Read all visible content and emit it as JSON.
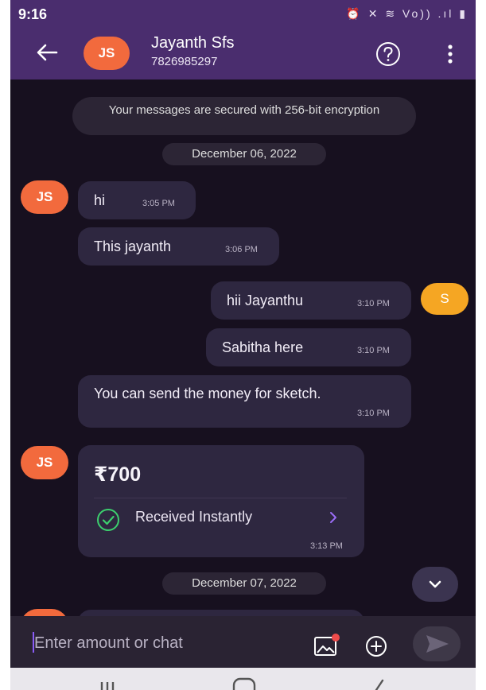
{
  "status_bar": {
    "time": "9:16",
    "icons": [
      "alarm-icon",
      "mute-icon",
      "wifi-icon",
      "volte-icon",
      "signal-icon",
      "battery-icon"
    ],
    "icon_text": "⏰ ✕ ≋ Vo)) .ıl ▮"
  },
  "header": {
    "avatar_initials": "JS",
    "contact_name": "Jayanth Sfs",
    "contact_phone": "7826985297"
  },
  "chat": {
    "encryption_notice": "Your messages are secured with 256-bit encryption",
    "date_1": "December 06, 2022",
    "date_2": "December 07, 2022",
    "received_avatar": "JS",
    "sent_avatar": "S",
    "messages": [
      {
        "direction": "in",
        "text": "hi",
        "time": "3:05 PM"
      },
      {
        "direction": "in",
        "text": "This jayanth",
        "time": "3:06 PM"
      },
      {
        "direction": "out",
        "text": "hii Jayanthu",
        "time": "3:10 PM"
      },
      {
        "direction": "out",
        "text": "Sabitha here",
        "time": "3:10 PM"
      },
      {
        "direction": "out",
        "text": "You can send the money for sketch.",
        "time": "3:10 PM"
      }
    ],
    "payment": {
      "amount": "₹700",
      "status": "Received Instantly",
      "time": "3:13 PM"
    }
  },
  "composer": {
    "placeholder": "Enter amount or chat"
  },
  "colors": {
    "header_bg": "#4a2d6e",
    "chat_bg": "#17101f",
    "bubble_bg": "#2e2740",
    "avatar_js": "#f26a3d",
    "avatar_s": "#f5a623",
    "success_green": "#3ccf6e",
    "accent_purple": "#8a5cf6"
  }
}
